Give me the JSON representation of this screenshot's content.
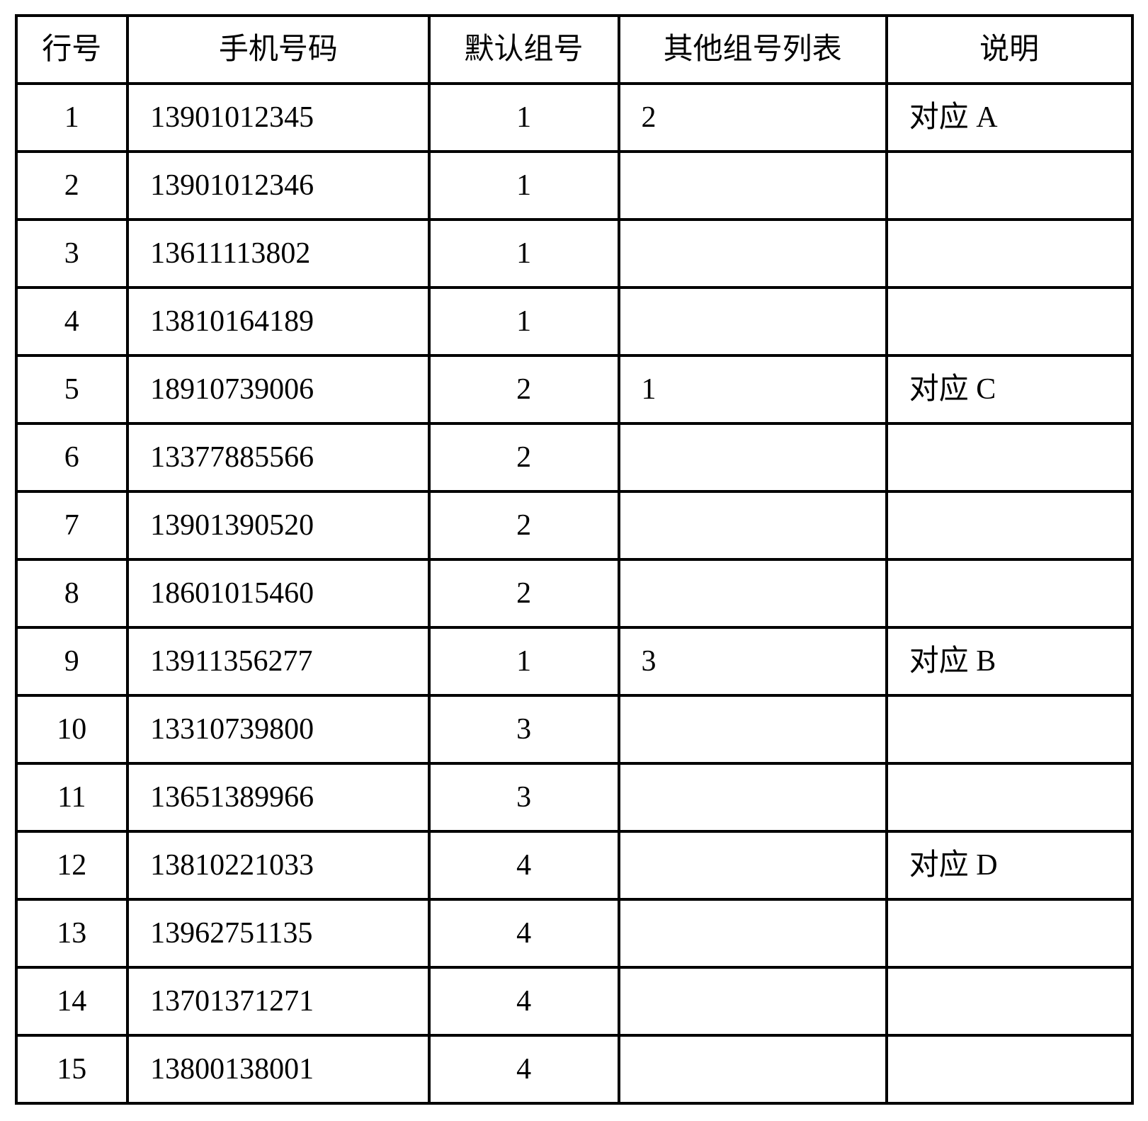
{
  "chart_data": {
    "type": "table",
    "headers": [
      "行号",
      "手机号码",
      "默认组号",
      "其他组号列表",
      "说明"
    ],
    "rows": [
      {
        "rownum": "1",
        "phone": "13901012345",
        "default_group": "1",
        "other_groups": "2",
        "note": "对应 A"
      },
      {
        "rownum": "2",
        "phone": "13901012346",
        "default_group": "1",
        "other_groups": "",
        "note": ""
      },
      {
        "rownum": "3",
        "phone": "13611113802",
        "default_group": "1",
        "other_groups": "",
        "note": ""
      },
      {
        "rownum": "4",
        "phone": "13810164189",
        "default_group": "1",
        "other_groups": "",
        "note": ""
      },
      {
        "rownum": "5",
        "phone": "18910739006",
        "default_group": "2",
        "other_groups": "1",
        "note": "对应 C"
      },
      {
        "rownum": "6",
        "phone": "13377885566",
        "default_group": "2",
        "other_groups": "",
        "note": ""
      },
      {
        "rownum": "7",
        "phone": "13901390520",
        "default_group": "2",
        "other_groups": "",
        "note": ""
      },
      {
        "rownum": "8",
        "phone": "18601015460",
        "default_group": "2",
        "other_groups": "",
        "note": ""
      },
      {
        "rownum": "9",
        "phone": "13911356277",
        "default_group": "1",
        "other_groups": "3",
        "note": "对应 B"
      },
      {
        "rownum": "10",
        "phone": "13310739800",
        "default_group": "3",
        "other_groups": "",
        "note": ""
      },
      {
        "rownum": "11",
        "phone": "13651389966",
        "default_group": "3",
        "other_groups": "",
        "note": ""
      },
      {
        "rownum": "12",
        "phone": "13810221033",
        "default_group": "4",
        "other_groups": "",
        "note": "对应 D"
      },
      {
        "rownum": "13",
        "phone": "13962751135",
        "default_group": "4",
        "other_groups": "",
        "note": ""
      },
      {
        "rownum": "14",
        "phone": "13701371271",
        "default_group": "4",
        "other_groups": "",
        "note": ""
      },
      {
        "rownum": "15",
        "phone": "13800138001",
        "default_group": "4",
        "other_groups": "",
        "note": ""
      }
    ]
  }
}
